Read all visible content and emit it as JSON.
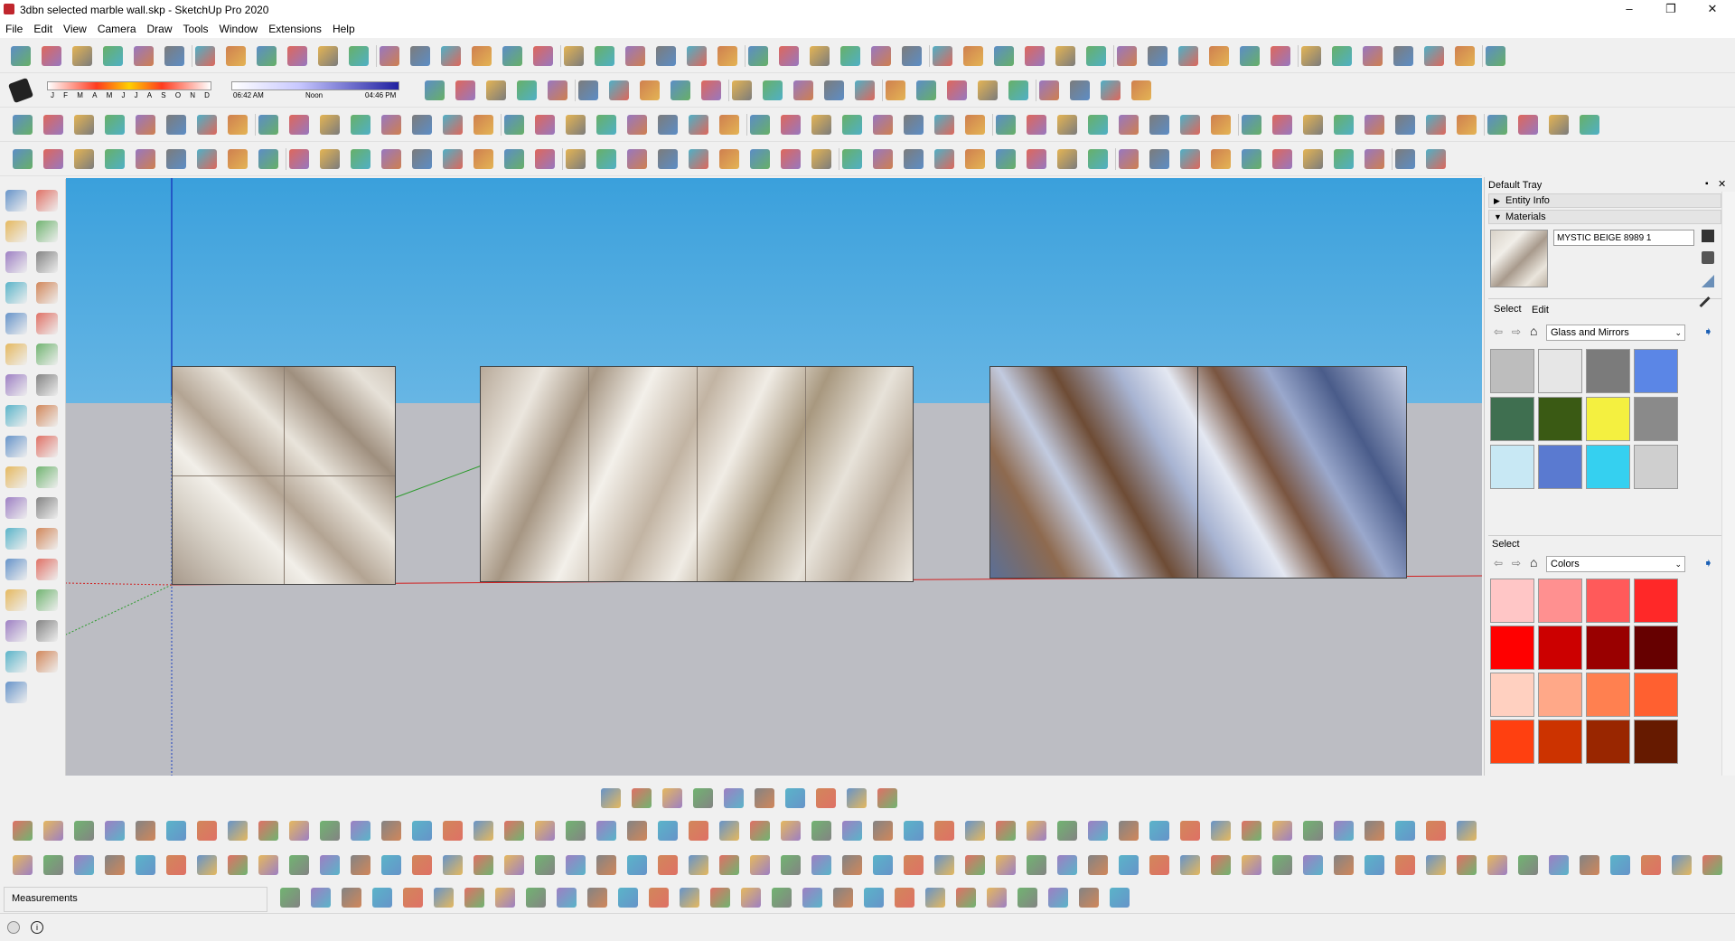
{
  "window": {
    "title": "3dbn selected marble wall.skp - SketchUp Pro 2020",
    "minimize": "–",
    "maximize": "❐",
    "close": "✕"
  },
  "menu": [
    "File",
    "Edit",
    "View",
    "Camera",
    "Draw",
    "Tools",
    "Window",
    "Extensions",
    "Help"
  ],
  "shadows": {
    "months": [
      "J",
      "F",
      "M",
      "A",
      "M",
      "J",
      "J",
      "A",
      "S",
      "O",
      "N",
      "D"
    ],
    "time_start": "06:42 AM",
    "time_mid": "Noon",
    "time_end": "04:46 PM"
  },
  "tray": {
    "title": "Default Tray",
    "entity_info": "Entity Info",
    "materials": "Materials",
    "material_name": "MYSTIC BEIGE 8989 1",
    "tab_select": "Select",
    "tab_edit": "Edit",
    "library_top": "Glass and Mirrors",
    "select2": "Select",
    "library_bottom": "Colors"
  },
  "status": {
    "measurements": "Measurements"
  }
}
